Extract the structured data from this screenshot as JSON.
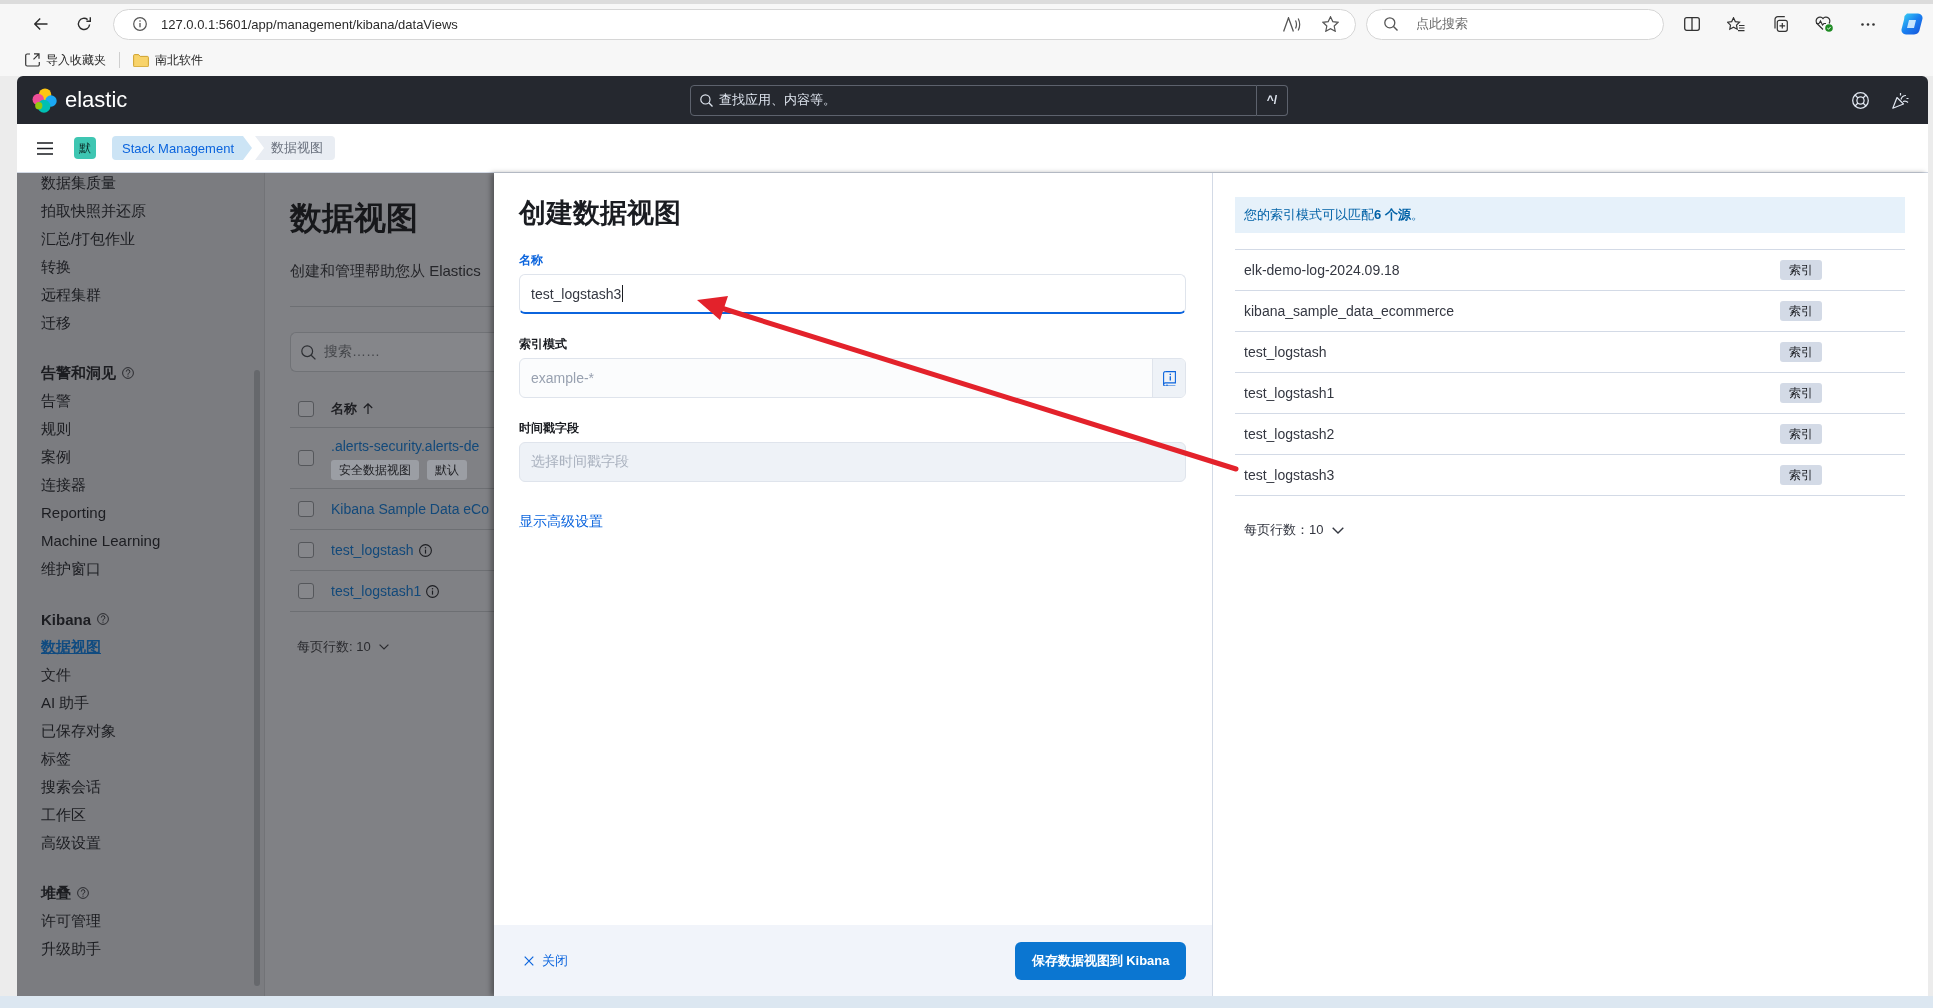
{
  "browser": {
    "url": "127.0.0.1:5601/app/management/kibana/dataViews",
    "search_placeholder": "点此搜索",
    "bookmarks": [
      {
        "label": "导入收藏夹",
        "kind": "import"
      },
      {
        "label": "南北软件",
        "kind": "folder"
      }
    ]
  },
  "header": {
    "logo_text": "elastic",
    "search_placeholder": "查找应用、内容等。",
    "shortcut": "^/"
  },
  "breadcrumb_bar": {
    "space_initial": "默",
    "breadcrumbs": [
      {
        "label": "Stack Management",
        "current": false
      },
      {
        "label": "数据视图",
        "current": true
      }
    ]
  },
  "sidebar": {
    "sections": [
      {
        "items": [
          {
            "label": "数据集质量",
            "selected": false
          },
          {
            "label": "拍取快照并还原",
            "selected": false
          },
          {
            "label": "汇总/打包作业",
            "selected": false
          },
          {
            "label": "转换",
            "selected": false
          },
          {
            "label": "远程集群",
            "selected": false
          },
          {
            "label": "迁移",
            "selected": false
          }
        ]
      },
      {
        "title": "告警和洞见",
        "items": [
          {
            "label": "告警",
            "selected": false
          },
          {
            "label": "规则",
            "selected": false
          },
          {
            "label": "案例",
            "selected": false
          },
          {
            "label": "连接器",
            "selected": false
          },
          {
            "label": "Reporting",
            "selected": false
          },
          {
            "label": "Machine Learning",
            "selected": false
          },
          {
            "label": "维护窗口",
            "selected": false
          }
        ]
      },
      {
        "title": "Kibana",
        "items": [
          {
            "label": "数据视图",
            "selected": true
          },
          {
            "label": "文件",
            "selected": false
          },
          {
            "label": "AI 助手",
            "selected": false
          },
          {
            "label": "已保存对象",
            "selected": false
          },
          {
            "label": "标签",
            "selected": false
          },
          {
            "label": "搜索会话",
            "selected": false
          },
          {
            "label": "工作区",
            "selected": false
          },
          {
            "label": "高级设置",
            "selected": false
          }
        ]
      },
      {
        "title": "堆叠",
        "items": [
          {
            "label": "许可管理",
            "selected": false
          },
          {
            "label": "升级助手",
            "selected": false
          }
        ]
      }
    ]
  },
  "page": {
    "title": "数据视图",
    "description": "创建和管理帮助您从 Elastics",
    "search_placeholder": "搜索……",
    "header_checked": false,
    "columns": [
      {
        "label": "名称",
        "sort_ascending": true
      }
    ],
    "rows": [
      {
        "name": ".alerts-security.alerts-de",
        "checked": false,
        "info": false,
        "badges": [
          "安全数据视图",
          "默认"
        ]
      },
      {
        "name": "Kibana Sample Data eCo",
        "checked": false,
        "info": false,
        "badges": []
      },
      {
        "name": "test_logstash",
        "checked": false,
        "info": true,
        "badges": []
      },
      {
        "name": "test_logstash1",
        "checked": false,
        "info": true,
        "badges": []
      }
    ],
    "rows_per_page": "每页行数: 10"
  },
  "flyout": {
    "title": "创建数据视图",
    "fields": [
      {
        "kind": "text",
        "label": "名称",
        "value": "test_logstash3",
        "focused": true,
        "disabled": false
      },
      {
        "kind": "pattern",
        "label": "索引模式",
        "placeholder": "example-*",
        "focused": false,
        "disabled": false
      },
      {
        "kind": "select",
        "label": "时间戳字段",
        "placeholder": "选择时间戳字段",
        "focused": false,
        "disabled": true
      }
    ],
    "advanced_link": "显示高级设置",
    "close_label": "关闭",
    "save_label": "保存数据视图到 Kibana"
  },
  "preview": {
    "callout": "您的索引模式可以匹配**6 个源**。",
    "sources": [
      {
        "name": "elk-demo-log-2024.09.18",
        "type": "索引"
      },
      {
        "name": "kibana_sample_data_ecommerce",
        "type": "索引"
      },
      {
        "name": "test_logstash",
        "type": "索引"
      },
      {
        "name": "test_logstash1",
        "type": "索引"
      },
      {
        "name": "test_logstash2",
        "type": "索引"
      },
      {
        "name": "test_logstash3",
        "type": "索引"
      }
    ],
    "rows_per_page": "每页行数：10"
  }
}
